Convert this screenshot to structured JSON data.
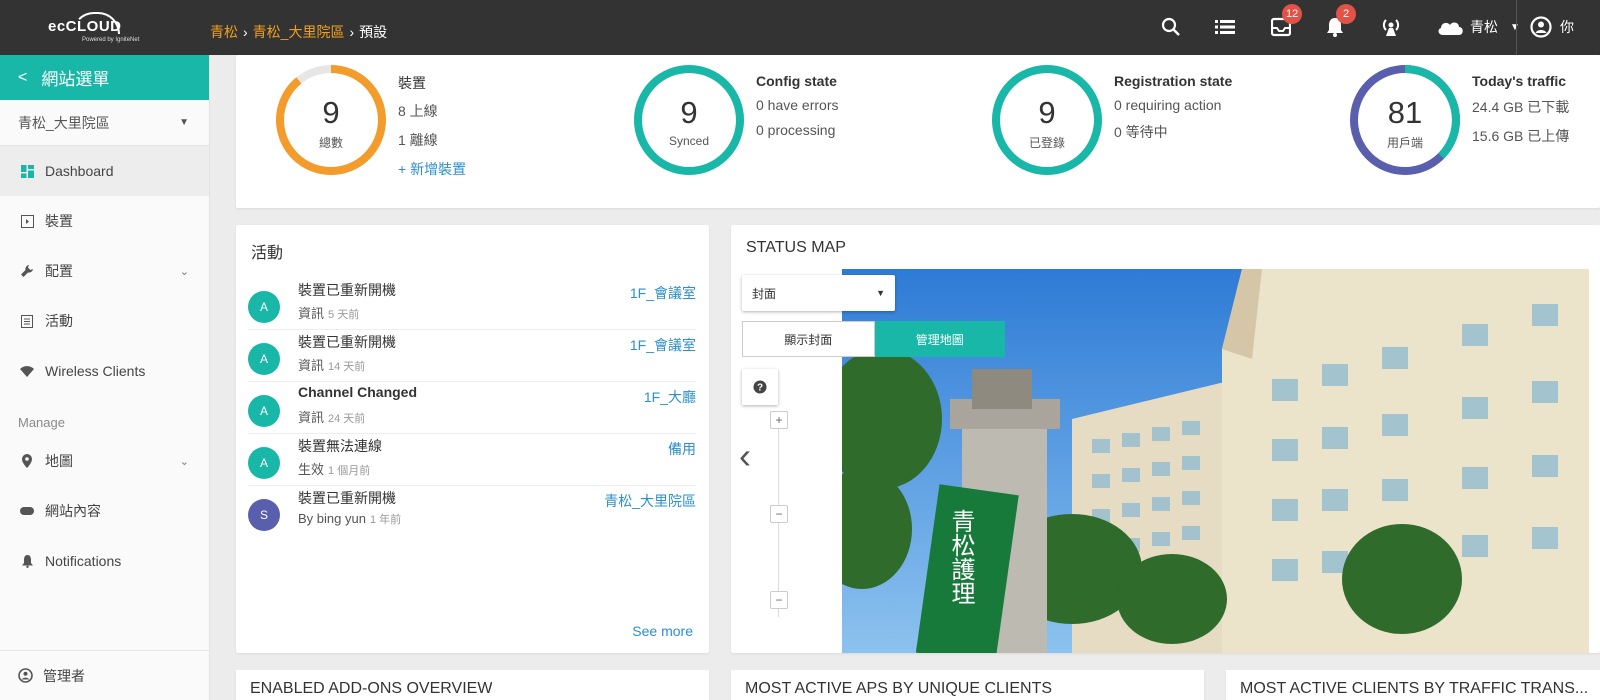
{
  "topbar": {
    "logo_main": "ecCLOUD",
    "logo_sub": "Powered by IgniteNet",
    "breadcrumb": [
      "青松",
      "青松_大里院區",
      "預設"
    ],
    "inbox_badge": "12",
    "notification_badge": "2",
    "user_name": "青松",
    "account_label": "你"
  },
  "sidebar": {
    "header": "網站選單",
    "site_select": "青松_大里院區",
    "items": [
      {
        "label": "Dashboard",
        "icon": "dashboard-icon"
      },
      {
        "label": "裝置",
        "icon": "device-icon"
      },
      {
        "label": "配置",
        "icon": "wrench-icon"
      },
      {
        "label": "活動",
        "icon": "list-icon"
      },
      {
        "label": "Wireless Clients",
        "icon": "wifi-icon"
      }
    ],
    "section_label": "Manage",
    "manage_items": [
      {
        "label": "地圖",
        "icon": "map-marker-icon"
      },
      {
        "label": "網站內容",
        "icon": "site-content-icon"
      },
      {
        "label": "Notifications",
        "icon": "bell-icon"
      }
    ],
    "bottom_label": "管理者"
  },
  "stats": [
    {
      "number": "9",
      "caption": "總數",
      "title": "裝置",
      "lines": [
        "8 上線",
        "1 離線"
      ],
      "link": "新增裝置",
      "ring_color": "#f39c2b",
      "ring_fraction": 0.89
    },
    {
      "number": "9",
      "caption": "Synced",
      "title": "Config state",
      "lines": [
        "0 have errors",
        "0 processing"
      ],
      "ring_color": "#19b7a8",
      "ring_fraction": 1.0
    },
    {
      "number": "9",
      "caption": "已登錄",
      "title": "Registration state",
      "lines": [
        "0 requiring action",
        "0 等待中"
      ],
      "ring_color": "#19b7a8",
      "ring_fraction": 1.0
    },
    {
      "number": "81",
      "caption": "用戶端",
      "title": "Today's traffic",
      "lines": [
        "24.4 GB 已下載",
        "15.6 GB 已上傳"
      ],
      "ring_color": "#5a5fad",
      "ring_color_2": "#19b7a8",
      "ring_fraction": 1.0
    }
  ],
  "activity": {
    "title": "活動",
    "items": [
      {
        "avatar": "A",
        "title": "裝置已重新開機",
        "sub": "資訊",
        "time": "5 天前",
        "location": "1F_會議室",
        "bold": false
      },
      {
        "avatar": "A",
        "title": "裝置已重新開機",
        "sub": "資訊",
        "time": "14 天前",
        "location": "1F_會議室",
        "bold": false
      },
      {
        "avatar": "A",
        "title": "Channel Changed",
        "sub": "資訊",
        "time": "24 天前",
        "location": "1F_大廳",
        "bold": true
      },
      {
        "avatar": "A",
        "title": "裝置無法連線",
        "sub": "生效",
        "time": "1 個月前",
        "location": "備用",
        "bold": false
      },
      {
        "avatar": "S",
        "title": "裝置已重新開機",
        "sub": "By bing yun",
        "time": "1 年前",
        "location": "青松_大里院區",
        "bold": false
      }
    ],
    "see_more": "See more"
  },
  "status_map": {
    "title": "STATUS MAP",
    "select_value": "封面",
    "tab_cover": "顯示封面",
    "tab_manage": "管理地圖",
    "zoom_in": "+",
    "zoom_out": "−",
    "sign_text": "青松護理"
  },
  "bottom_cards": [
    "ENABLED ADD-ONS OVERVIEW",
    "MOST ACTIVE APS BY UNIQUE CLIENTS",
    "MOST ACTIVE CLIENTS BY TRAFFIC TRANS..."
  ],
  "colors": {
    "accent": "#19b7a8",
    "link": "#2b8fd0",
    "topbar": "#333333",
    "badge": "#e35247",
    "avatar_a": "#19b7a8",
    "avatar_s": "#5a5fad"
  }
}
